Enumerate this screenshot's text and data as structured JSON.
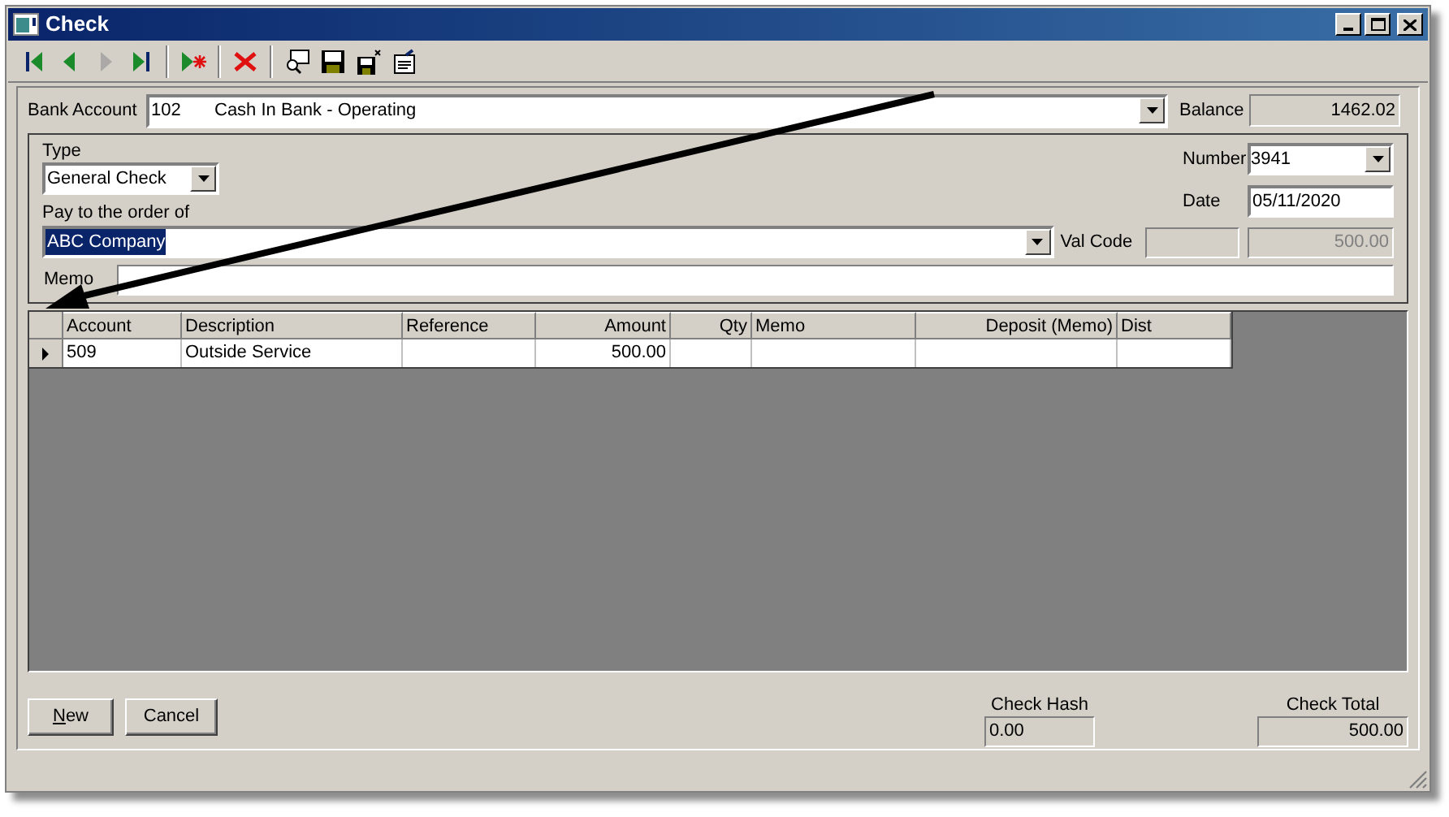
{
  "window": {
    "title": "Check"
  },
  "toolbar": [
    {
      "kind": "first",
      "disabled": false
    },
    {
      "kind": "prev",
      "disabled": false
    },
    {
      "kind": "next",
      "disabled": true
    },
    {
      "kind": "last",
      "disabled": false
    },
    {
      "kind": "new",
      "disabled": false
    },
    {
      "kind": "delete",
      "disabled": false
    },
    {
      "kind": "find",
      "disabled": false
    },
    {
      "kind": "save",
      "disabled": false
    },
    {
      "kind": "save-close",
      "disabled": false
    },
    {
      "kind": "properties",
      "disabled": false
    }
  ],
  "bank_account": {
    "label": "Bank Account",
    "number": "102",
    "name": "Cash In Bank - Operating"
  },
  "balance": {
    "label": "Balance",
    "value": "1462.02"
  },
  "type": {
    "label": "Type",
    "value": "General Check"
  },
  "number": {
    "label": "Number",
    "value": "3941"
  },
  "date": {
    "label": "Date",
    "value": "05/11/2020"
  },
  "pay_to": {
    "label": "Pay to the order of",
    "value": "ABC Company",
    "selected": true
  },
  "val_code": {
    "label": "Val Code",
    "amount": "500.00"
  },
  "memo": {
    "label": "Memo"
  },
  "table": {
    "columns": [
      {
        "label": "Account"
      },
      {
        "label": "Description"
      },
      {
        "label": "Reference"
      },
      {
        "label": "Amount"
      },
      {
        "label": "Qty"
      },
      {
        "label": "Memo"
      },
      {
        "label": "Deposit (Memo)"
      },
      {
        "label": "Dist"
      }
    ],
    "rows": [
      {
        "current": true,
        "cells": [
          "509",
          "Outside Service",
          "",
          "500.00",
          "",
          "",
          "",
          ""
        ]
      }
    ]
  },
  "buttons": [
    {
      "label": "New",
      "mnemonic": true
    },
    {
      "label": "Cancel",
      "mnemonic": false
    }
  ],
  "check_hash": {
    "label": "Check Hash",
    "value": "0.00"
  },
  "check_total": {
    "label": "Check Total",
    "value": "500.00"
  }
}
